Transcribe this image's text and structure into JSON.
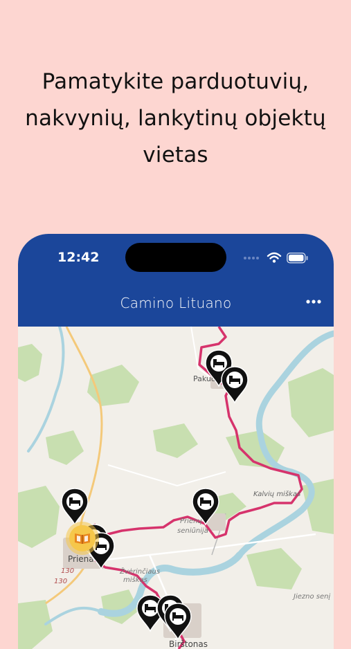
{
  "headline": "Pamatykite parduotuvių, nakvynių, lankytinų objektų vietas",
  "status": {
    "time": "12:42"
  },
  "app": {
    "title": "Camino Lituano",
    "more_icon": "more-horizontal-icon"
  },
  "map": {
    "places": {
      "pakuonis": "Pakuonis",
      "prienai": "Priena",
      "birstonas": "Birštonas",
      "kalviu_miskas": "Kalvių miškas",
      "prienu_seniunija_1": "Prienų",
      "prienu_seniunija_2": "seniūnija",
      "zveriniciaus": "Žvėrinčiaus",
      "miskas": "miškas",
      "jiezno": "Jiezno senį",
      "road_130_a": "130",
      "road_130_b": "130"
    },
    "markers": [
      {
        "type": "lodging",
        "icon": "bed-icon"
      },
      {
        "type": "lodging",
        "icon": "bed-icon"
      },
      {
        "type": "lodging",
        "icon": "bed-icon"
      },
      {
        "type": "lodging",
        "icon": "bed-icon"
      },
      {
        "type": "lodging",
        "icon": "bed-icon"
      },
      {
        "type": "lodging",
        "icon": "bed-icon"
      },
      {
        "type": "lodging",
        "icon": "bed-icon"
      },
      {
        "type": "lodging",
        "icon": "bed-icon"
      },
      {
        "type": "lodging",
        "icon": "bed-icon"
      },
      {
        "type": "attraction",
        "icon": "book-icon"
      }
    ],
    "colors": {
      "route": "#d6336c",
      "river": "#aad3df",
      "forest": "#c8dfb0",
      "land": "#f2efe9",
      "pin": "#111111",
      "attraction": "#f6c74a",
      "appbar": "#1b469a",
      "background": "#fdd6d1"
    }
  }
}
